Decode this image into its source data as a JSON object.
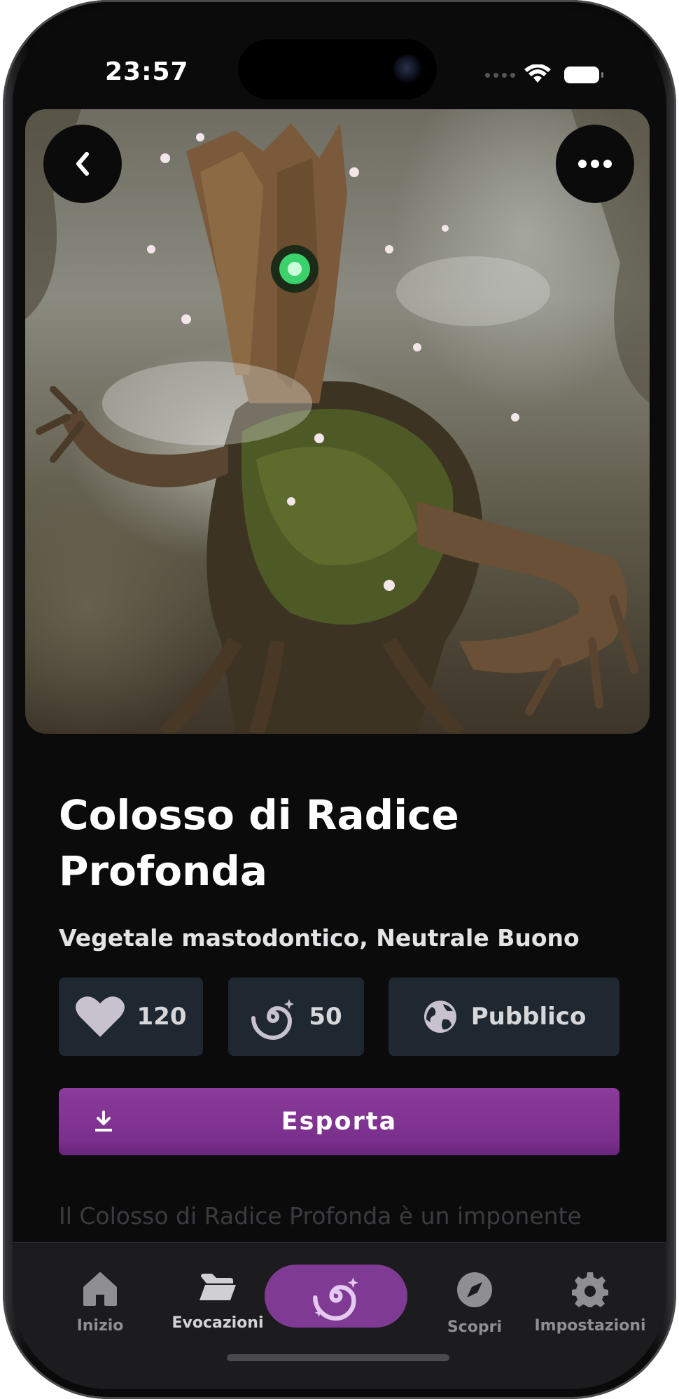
{
  "status_bar": {
    "time": "23:57"
  },
  "header": {
    "back_icon": "chevron-left-icon",
    "more_icon": "more-horizontal-icon"
  },
  "hero": {
    "subject": "Ancient tree creature with glowing green eye, moss and flowers"
  },
  "creature": {
    "title": "Colosso di Radice Profonda",
    "subtitle": "Vegetale mastodontico, Neutrale Buono"
  },
  "stats": {
    "likes": "120",
    "energy": "50",
    "visibility": "Pubblico"
  },
  "actions": {
    "export_label": "Esporta"
  },
  "description": "Il Colosso di Radice Profonda è un imponente essere che emerge dalle foreste più antiche del",
  "tabbar": {
    "items": [
      {
        "label": "Inizio",
        "icon": "home-icon"
      },
      {
        "label": "Evocazioni",
        "icon": "folder-icon"
      },
      {
        "label": "Scopri",
        "icon": "compass-icon"
      },
      {
        "label": "Impostazioni",
        "icon": "gear-icon"
      }
    ],
    "fab_icon": "galaxy-spiral-icon"
  },
  "colors": {
    "background": "#0b0b0b",
    "accent": "#7f3a93",
    "stat_chip": "#1f2730",
    "tabbar": "#1c1c1e"
  }
}
